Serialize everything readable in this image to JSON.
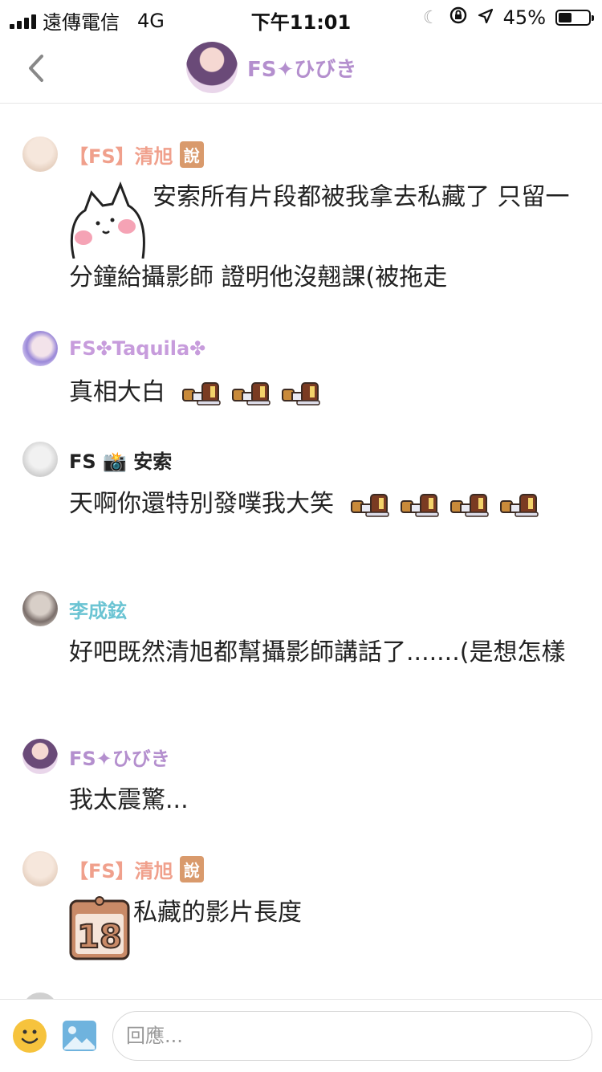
{
  "status_bar": {
    "carrier": "遠傳電信",
    "network": "4G",
    "time": "下午11:01",
    "battery_percent": 45,
    "battery_text": "45%"
  },
  "nav": {
    "title": "FS✦ひびき"
  },
  "messages": [
    {
      "name": "【FS】清旭",
      "name_color": "#f0a08c",
      "badge": "說",
      "text": "安索所有片段都被我拿去私藏了 只留一分鐘給攝影師 證明他沒翹課(被拖走",
      "sticker": "cat-sticker"
    },
    {
      "name": "FS✤Taquila✤",
      "name_color": "#c79cdc",
      "text": "真相大白",
      "emojis": 3
    },
    {
      "name": "FS 📸 安索",
      "name_color": "#222222",
      "text": "天啊你還特別發噗我大笑",
      "emojis": 4
    },
    {
      "name": "李成鉉",
      "name_color": "#6bc4d3",
      "text": "好吧既然清旭都幫攝影師講話了.......(是想怎樣"
    },
    {
      "name": "FS✦ひびき",
      "name_color": "#b48fce",
      "text": "我太震驚..."
    },
    {
      "name": "【FS】清旭",
      "name_color": "#f0a08c",
      "badge": "說",
      "text": "私藏的影片長度",
      "sticker": "calendar-18-sticker",
      "sticker_number": "18"
    }
  ],
  "composer": {
    "placeholder": "回應..."
  }
}
